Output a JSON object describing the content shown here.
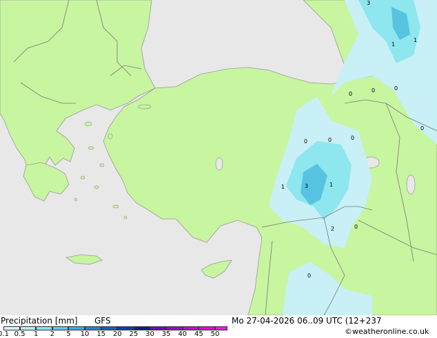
{
  "product": {
    "title": "Precipitation [mm]",
    "model": "GFS",
    "valid_time": "Mo 27-04-2026 06..09 UTC (12+237",
    "credit": "©weatheronline.co.uk"
  },
  "colors": {
    "sea": "#e8e8e8",
    "land": "#c8f5a0",
    "coast": "#9a9a9a",
    "border": "#787878",
    "precip_light": "#c8f0f6",
    "precip_mid": "#8ee6ee",
    "precip_heavy": "#56c4e0"
  },
  "legend": {
    "ticks": [
      "0.1",
      "0.5",
      "1",
      "2",
      "5",
      "10",
      "15",
      "20",
      "25",
      "30",
      "35",
      "40",
      "45",
      "50"
    ],
    "swatches": [
      "#d4f4fa",
      "#b4ecf6",
      "#8ae0f2",
      "#58cdea",
      "#2ab4e0",
      "#1a88d4",
      "#1460c8",
      "#0e3cb4",
      "#0a1e96",
      "#6e0ac8",
      "#9a0ad2",
      "#c40adc",
      "#e00ae0",
      "#f01ae4"
    ]
  },
  "map_labels": [
    {
      "text": "3"
    },
    {
      "text": "1"
    },
    {
      "text": "1"
    },
    {
      "text": "0"
    },
    {
      "text": "0"
    },
    {
      "text": "0"
    },
    {
      "text": "0"
    },
    {
      "text": "0"
    },
    {
      "text": "0"
    },
    {
      "text": "0"
    },
    {
      "text": "1"
    },
    {
      "text": "3"
    },
    {
      "text": "1"
    },
    {
      "text": "2"
    },
    {
      "text": "0"
    },
    {
      "text": "0"
    }
  ]
}
